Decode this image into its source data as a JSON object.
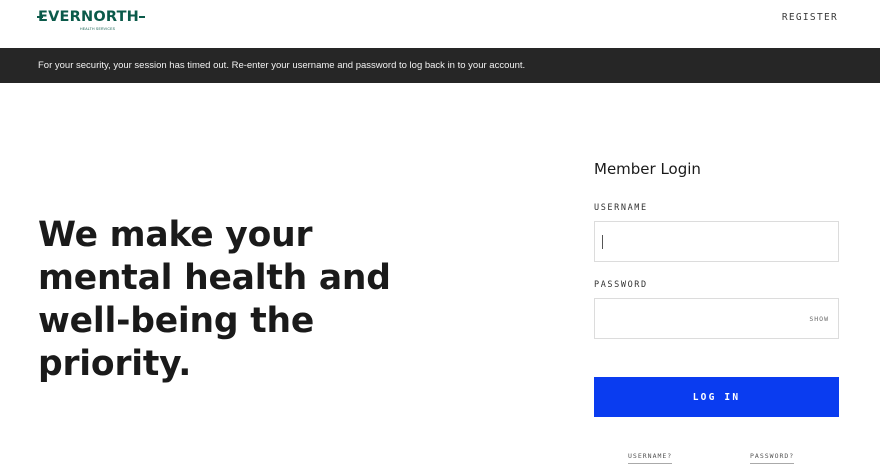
{
  "header": {
    "logo_text": "EVERNORTH",
    "logo_subtext": "HEALTH SERVICES",
    "register_label": "REGISTER"
  },
  "alert": {
    "message": "For your security, your session has timed out. Re-enter your username and password to log back in to your account."
  },
  "hero": {
    "line1": "We make your",
    "line2": "mental health and",
    "line3": "well-being the",
    "line4": "priority."
  },
  "login": {
    "title": "Member Login",
    "username_label": "USERNAME",
    "username_value": "",
    "password_label": "PASSWORD",
    "password_value": "",
    "show_label": "SHOW",
    "submit_label": "LOG IN",
    "forgot_username_label": "USERNAME?",
    "forgot_password_label": "PASSWORD?"
  },
  "colors": {
    "brand": "#0b5a4a",
    "alert_bg": "#262626",
    "primary_button": "#0a3cf0"
  }
}
